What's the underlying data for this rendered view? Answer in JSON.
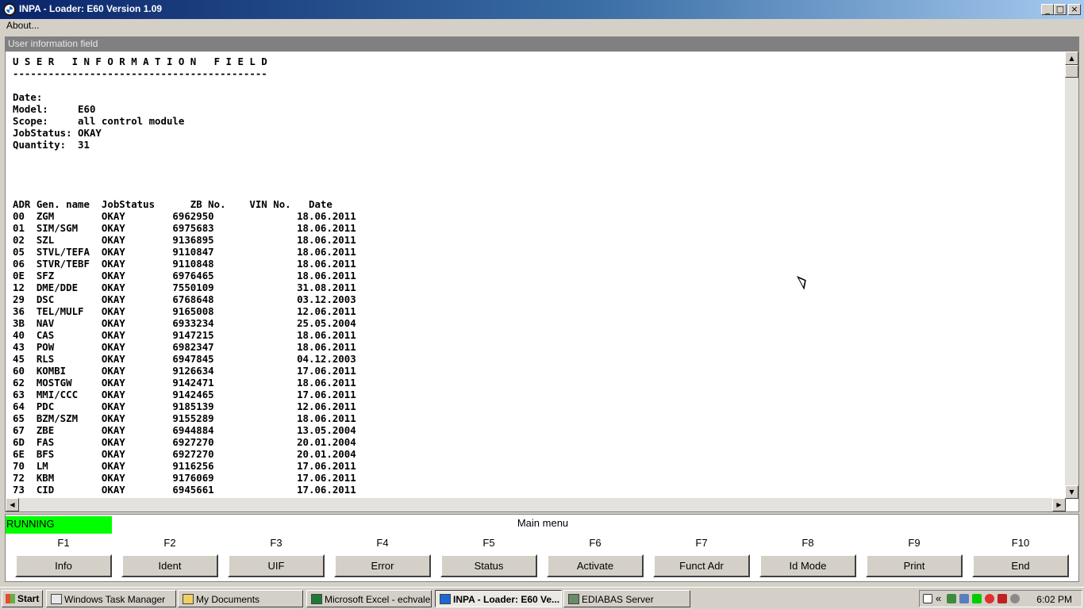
{
  "window": {
    "title": "INPA - Loader:  E60 Version 1.09",
    "buttons": {
      "minimize": "_",
      "maximize": "□",
      "close": "×"
    }
  },
  "menubar": {
    "about": "About..."
  },
  "uif": {
    "header": "User information field",
    "lines": [
      "U S E R   I N F O R M A T I O N   F I E L D",
      "-------------------------------------------",
      "",
      "Date:",
      "Model:     E60",
      "Scope:     all control module",
      "JobStatus: OKAY",
      "Quantity:  31",
      "",
      "",
      "",
      "",
      "ADR Gen. name  JobStatus      ZB No.    VIN No.   Date",
      "00  ZGM        OKAY        6962950              18.06.2011",
      "01  SIM/SGM    OKAY        6975683              18.06.2011",
      "02  SZL        OKAY        9136895              18.06.2011",
      "05  STVL/TEFA  OKAY        9110847              18.06.2011",
      "06  STVR/TEBF  OKAY        9110848              18.06.2011",
      "0E  SFZ        OKAY        6976465              18.06.2011",
      "12  DME/DDE    OKAY        7550109              31.08.2011",
      "29  DSC        OKAY        6768648              03.12.2003",
      "36  TEL/MULF   OKAY        9165008              12.06.2011",
      "3B  NAV        OKAY        6933234              25.05.2004",
      "40  CAS        OKAY        9147215              18.06.2011",
      "43  POW        OKAY        6982347              18.06.2011",
      "45  RLS        OKAY        6947845              04.12.2003",
      "60  KOMBI      OKAY        9126634              17.06.2011",
      "62  MOSTGW     OKAY        9142471              18.06.2011",
      "63  MMI/CCC    OKAY        9142465              17.06.2011",
      "64  PDC        OKAY        9185139              12.06.2011",
      "65  BZM/SZM    OKAY        9155289              18.06.2011",
      "67  ZBE        OKAY        6944884              13.05.2004",
      "6D  FAS        OKAY        6927270              20.01.2004",
      "6E  BFS        OKAY        6927270              20.01.2004",
      "70  LM         OKAY        9116256              17.06.2011",
      "72  KBM        OKAY        9176069              17.06.2011",
      "73  CID        OKAY        6945661              17.06.2011"
    ],
    "scroll_arrows": {
      "up": "▲",
      "down": "▼",
      "left": "◀",
      "right": "▶"
    }
  },
  "status": {
    "running": "RUNNING",
    "status_color": "#00ff00"
  },
  "main_menu": {
    "title": "Main menu",
    "fkeys": [
      {
        "key": "F1",
        "label": "Info"
      },
      {
        "key": "F2",
        "label": "Ident"
      },
      {
        "key": "F3",
        "label": "UIF"
      },
      {
        "key": "F4",
        "label": "Error"
      },
      {
        "key": "F5",
        "label": "Status"
      },
      {
        "key": "F6",
        "label": "Activate"
      },
      {
        "key": "F7",
        "label": "Funct Adr"
      },
      {
        "key": "F8",
        "label": "Id Mode"
      },
      {
        "key": "F9",
        "label": "Print"
      },
      {
        "key": "F10",
        "label": "End"
      }
    ]
  },
  "taskbar": {
    "start": "Start",
    "tasks": [
      {
        "label": "Windows Task Manager",
        "icon": "task-manager-icon"
      },
      {
        "label": "My Documents",
        "icon": "folder-icon"
      },
      {
        "label": "Microsoft Excel - echvale...",
        "icon": "excel-icon"
      },
      {
        "label": "INPA - Loader:  E60 Ve...",
        "icon": "bmw-icon"
      },
      {
        "label": "EDIABAS Server",
        "icon": "server-icon"
      }
    ],
    "tray": {
      "expand": "«",
      "clock": "6:02 PM"
    }
  }
}
